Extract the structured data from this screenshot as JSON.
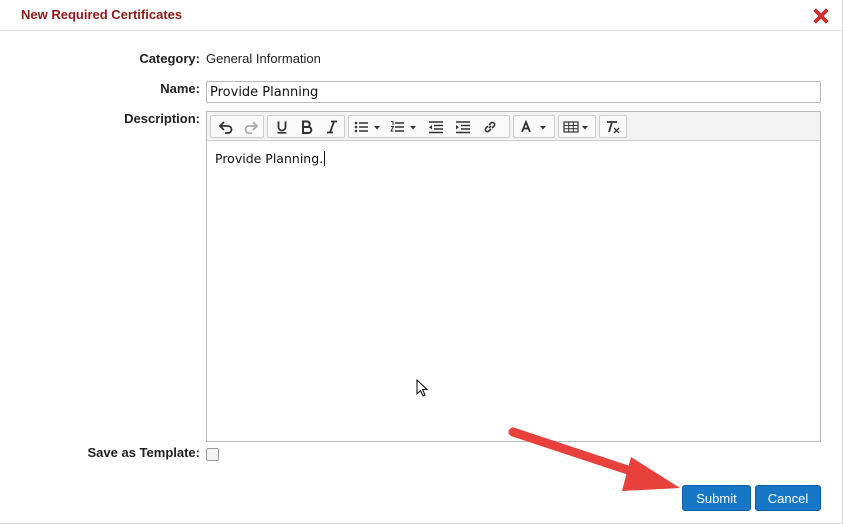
{
  "dialog": {
    "title": "New Required Certificates",
    "close_icon": "close-x-icon"
  },
  "form": {
    "category_label": "Category:",
    "category_value": "General Information",
    "name_label": "Name:",
    "name_value": "Provide Planning",
    "description_label": "Description:",
    "description_text": "Provide Planning.",
    "save_template_label": "Save as Template:",
    "save_template_checked": false
  },
  "toolbar": {
    "groups": [
      [
        "undo-icon",
        "redo-icon"
      ],
      [
        "underline-icon",
        "bold-icon",
        "italic-icon"
      ],
      [
        "bulleted-list-icon",
        "numbered-list-icon",
        "outdent-icon",
        "indent-icon",
        "link-icon"
      ],
      [
        "font-color-icon"
      ],
      [
        "table-icon"
      ],
      [
        "clear-format-icon"
      ]
    ]
  },
  "buttons": {
    "submit": "Submit",
    "cancel": "Cancel"
  },
  "colors": {
    "title": "#8b1a1a",
    "button": "#1677c6",
    "close": "#e03030",
    "annotation_arrow": "#e8403a"
  }
}
